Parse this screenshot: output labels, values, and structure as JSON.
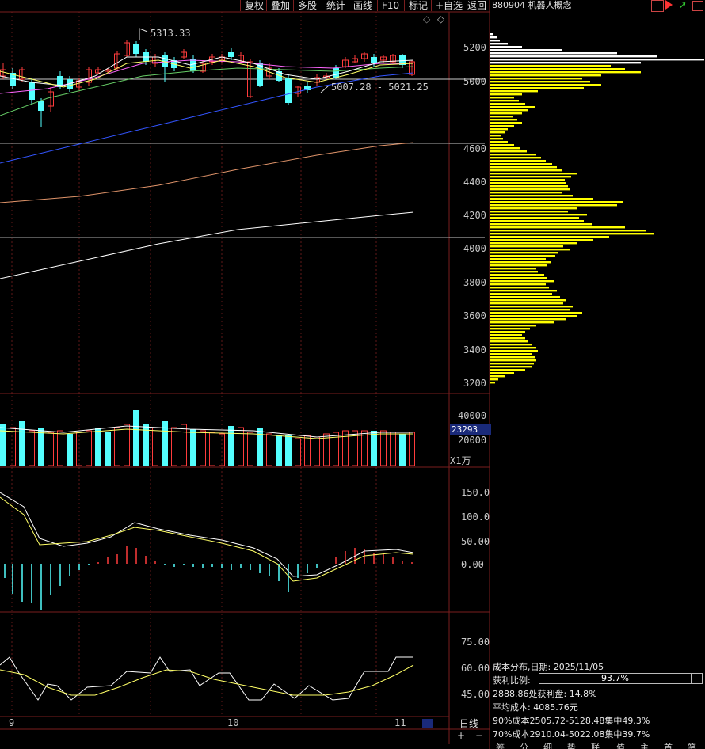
{
  "toolbar": {
    "buttons": [
      "复权",
      "叠加",
      "多股",
      "统计",
      "画线",
      "F10",
      "标记",
      "+自选",
      "返回"
    ],
    "code_title": "880904 机器人概念"
  },
  "main": {
    "high_label": "5313.33",
    "range_label": "5007.28 - 5021.25",
    "price_axis": [
      "5200",
      "5000",
      "4600",
      "4400",
      "4200",
      "4000",
      "3800",
      "3600",
      "3400",
      "3200"
    ]
  },
  "volume": {
    "axis": [
      "40000",
      "20000"
    ],
    "current": "23293",
    "unit": "X1万"
  },
  "macd": {
    "axis": [
      "150.0",
      "100.0",
      "50.00",
      "0.00"
    ]
  },
  "kdj": {
    "axis": [
      "75.00",
      "60.00",
      "45.00"
    ]
  },
  "date_axis": {
    "labels": [
      "9",
      "10",
      "11"
    ],
    "period_button": "日线",
    "zoom_in": "+",
    "zoom_out": "−"
  },
  "cost_info": {
    "line1": "成本分布,日期: 2025/11/05",
    "profit_label": "获利比例:",
    "profit_pct": "93.7%",
    "profit_fraction": 0.937,
    "line3": "2888.86处获利盘: 14.8%",
    "line4": "平均成本: 4085.76元",
    "line5": "90%成本2505.72-5128.48集中49.3%",
    "line6": "70%成本2910.04-5022.08集中39.7%"
  },
  "bottom_tabs": [
    "筹",
    "分",
    "细",
    "势",
    "联",
    "值",
    "主",
    "首",
    "笔"
  ],
  "colors": {
    "grid": "#7a1e1e",
    "up": "#ff3c3c",
    "down": "#54ffff",
    "chip": "#ffff00",
    "ma_white": "#ffffff",
    "ma_yellow": "#ffff66",
    "ma_magenta": "#ff66ff",
    "ma_green": "#66cc66",
    "ma_blue": "#3355ff",
    "ma_orange": "#e0946a"
  }
}
